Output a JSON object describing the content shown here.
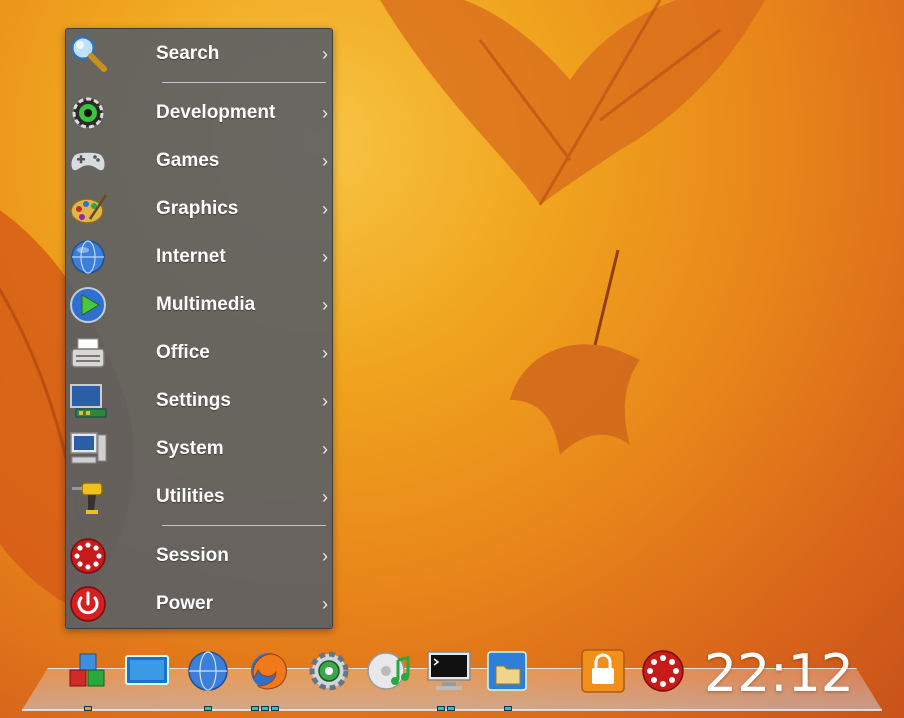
{
  "menu": {
    "items": [
      {
        "label": "Search",
        "icon": "search-icon",
        "arrow": "›"
      },
      {
        "label": "Development",
        "icon": "development-icon",
        "arrow": "›"
      },
      {
        "label": "Games",
        "icon": "gamepad-icon",
        "arrow": "›"
      },
      {
        "label": "Graphics",
        "icon": "palette-icon",
        "arrow": "›"
      },
      {
        "label": "Internet",
        "icon": "globe-icon",
        "arrow": "›"
      },
      {
        "label": "Multimedia",
        "icon": "play-icon",
        "arrow": "›"
      },
      {
        "label": "Office",
        "icon": "typewriter-icon",
        "arrow": "›"
      },
      {
        "label": "Settings",
        "icon": "settings-computer-icon",
        "arrow": "›"
      },
      {
        "label": "System",
        "icon": "computer-icon",
        "arrow": "›"
      },
      {
        "label": "Utilities",
        "icon": "drill-icon",
        "arrow": "›"
      },
      {
        "label": "Session",
        "icon": "session-icon",
        "arrow": "›"
      },
      {
        "label": "Power",
        "icon": "power-icon",
        "arrow": "›"
      }
    ]
  },
  "taskbar": {
    "launchers": [
      "app-menu-icon",
      "desktop-icon",
      "browser-globe-icon",
      "firefox-icon",
      "settings-gear-icon",
      "media-player-icon",
      "terminal-icon",
      "file-manager-icon",
      "lock-icon",
      "session-icon"
    ],
    "clock": "22:12"
  },
  "colors": {
    "menu_bg": "#5c6064",
    "accent_teal": "#2fc7a8",
    "accent_orange": "#f29d2c",
    "wallpaper": "#e8861a"
  }
}
